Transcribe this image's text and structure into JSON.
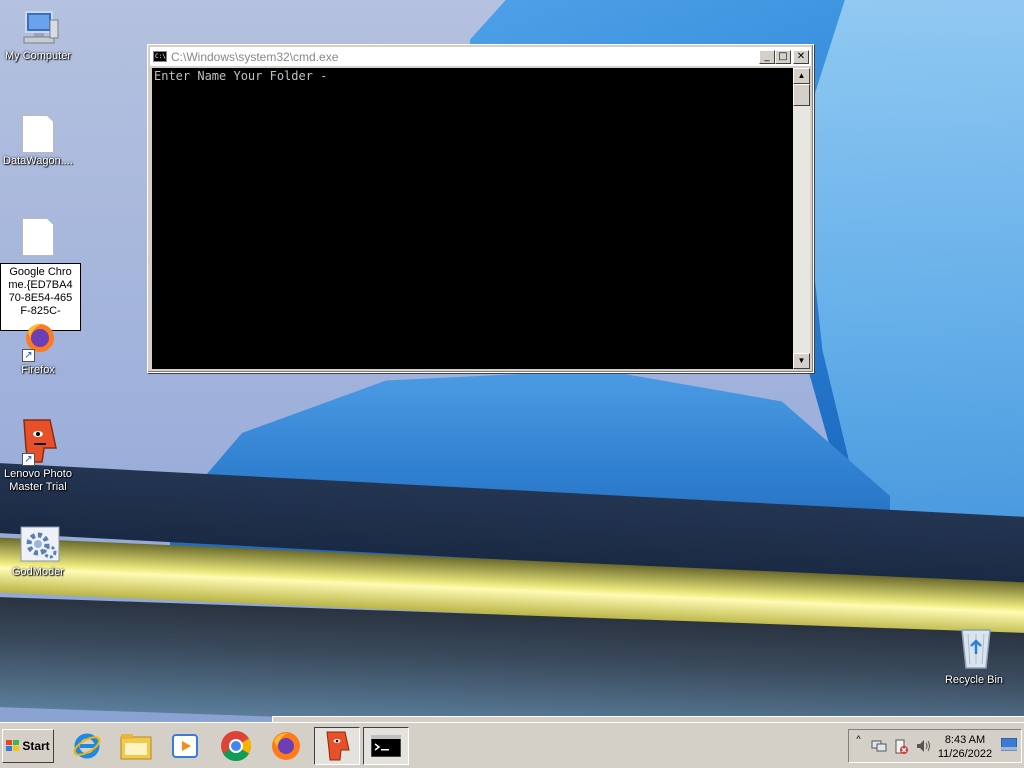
{
  "desktop": {
    "icons": [
      {
        "label": "My Computer"
      },
      {
        "label": "DataWagon...."
      },
      {
        "label": "Firefox"
      },
      {
        "label": "Lenovo Photo Master Trial"
      },
      {
        "label": "GodModer"
      },
      {
        "label": "Recycle Bin"
      }
    ],
    "rename_text": "Google Chrome.{ED7BA470-8E54-465F-825C-"
  },
  "cmd": {
    "title": "C:\\Windows\\system32\\cmd.exe",
    "icon_text": "C:\\",
    "output": "Enter Name Your Folder -",
    "minimize": "_",
    "maximize": "□",
    "close": "✕",
    "scroll_up": "▲",
    "scroll_down": "▼"
  },
  "taskbar": {
    "start_label": "Start",
    "apps": [
      {
        "icon": "internet-explorer-icon"
      },
      {
        "icon": "file-explorer-icon"
      },
      {
        "icon": "media-player-icon"
      },
      {
        "icon": "chrome-icon"
      },
      {
        "icon": "firefox-icon"
      },
      {
        "icon": "lenovo-photo-master-icon"
      },
      {
        "icon": "cmd-icon"
      }
    ],
    "tray": {
      "time": "8:43 AM",
      "date": "11/26/2022",
      "chevron": "˄"
    }
  },
  "colors": {
    "console_bg": "#000000",
    "console_text": "#c0c0c0",
    "window_chrome": "#d4d0c8"
  }
}
